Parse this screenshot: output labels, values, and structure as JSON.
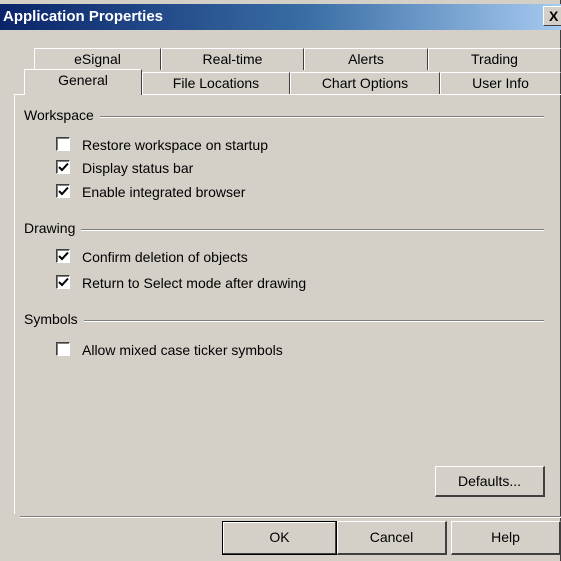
{
  "window": {
    "title": "Application Properties",
    "close_label": "X"
  },
  "tabs": {
    "back_row": [
      "eSignal",
      "Real-time",
      "Alerts",
      "Trading"
    ],
    "front_row": [
      "General",
      "File Locations",
      "Chart Options",
      "User Info"
    ],
    "active": "General"
  },
  "groups": {
    "workspace": {
      "label": "Workspace",
      "options": [
        {
          "label": "Restore workspace on startup",
          "checked": false
        },
        {
          "label": "Display status bar",
          "checked": true
        },
        {
          "label": "Enable integrated browser",
          "checked": true
        }
      ]
    },
    "drawing": {
      "label": "Drawing",
      "options": [
        {
          "label": "Confirm deletion of objects",
          "checked": true
        },
        {
          "label": "Return to Select mode after drawing",
          "checked": true
        }
      ]
    },
    "symbols": {
      "label": "Symbols",
      "options": [
        {
          "label": "Allow mixed case ticker symbols",
          "checked": false
        }
      ]
    }
  },
  "buttons": {
    "defaults": "Defaults...",
    "ok": "OK",
    "cancel": "Cancel",
    "help": "Help"
  },
  "colors": {
    "title_gradient_start": "#0a246a",
    "title_gradient_end": "#a6caf0",
    "face": "#d4d0c8"
  }
}
